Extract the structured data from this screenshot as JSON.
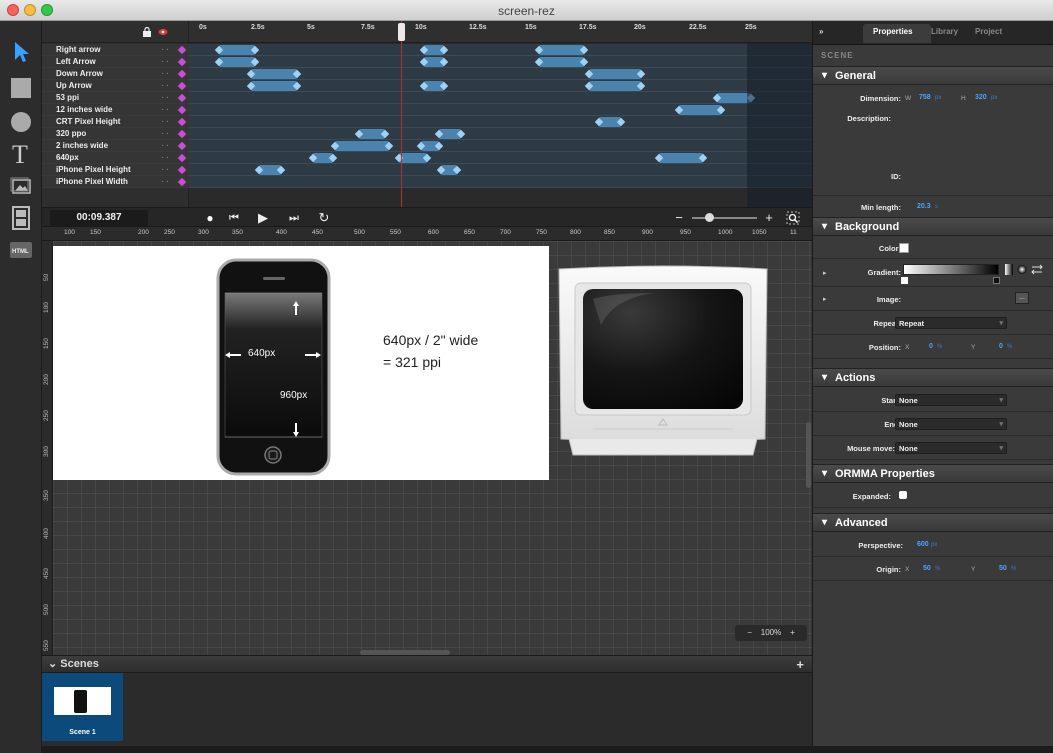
{
  "window": {
    "title": "screen-rez"
  },
  "timeline": {
    "layers": [
      "Right arrow",
      "Left Arrow",
      "Down Arrow",
      "Up Arrow",
      "53 ppi",
      "12 inches wide",
      "CRT Pixel Height",
      "320 ppo",
      "2 inches wide",
      "640px",
      "iPhone Pixel Height",
      "iPhone Pixel Width"
    ],
    "ruler_labels": [
      "0s",
      "2.5s",
      "5s",
      "7.5s",
      "10s",
      "12.5s",
      "15s",
      "17.5s",
      "20s",
      "22.5s",
      "25s"
    ],
    "layer_dots": "·  ·",
    "lock_icon": "lock-icon",
    "visibility_icon": "eye-icon"
  },
  "transport": {
    "timecode": "00:09.387",
    "record": "●",
    "rewind": "⏮",
    "play": "▶",
    "forward": "⏭",
    "loop": "↻",
    "zoom_out": "−",
    "zoom_in": "+"
  },
  "stage_ruler": {
    "horizontal": [
      "100",
      "150",
      "200",
      "250",
      "300",
      "350",
      "400",
      "450",
      "500",
      "550",
      "600",
      "650",
      "700",
      "750",
      "800",
      "850",
      "900",
      "950",
      "1000",
      "1050",
      "11"
    ],
    "vertical": [
      "50",
      "100",
      "150",
      "200",
      "250",
      "300",
      "350",
      "400",
      "450",
      "500",
      "550"
    ]
  },
  "stage": {
    "iphone_width_label": "640px",
    "iphone_height_label": "960px",
    "caption_line1": "640px / 2\" wide",
    "caption_line2": "= 321 ppi",
    "zoom": "100%",
    "zoom_minus": "−",
    "zoom_plus": "+"
  },
  "scenes": {
    "header": "Scenes",
    "add": "+",
    "items": [
      {
        "label": "Scene 1"
      }
    ]
  },
  "inspector": {
    "collapse": "»",
    "tabs": [
      "Properties",
      "Library",
      "Project"
    ],
    "active_tab": "Properties",
    "caption": "SCENE",
    "sections": {
      "general": "General",
      "background": "Background",
      "actions": "Actions",
      "ormma": "ORMMA Properties",
      "advanced": "Advanced"
    },
    "general": {
      "dimension_label": "Dimension:",
      "w_label": "W",
      "w_value": "758",
      "w_unit": "px",
      "h_label": "H",
      "h_value": "320",
      "h_unit": "px",
      "description_label": "Description:",
      "id_label": "ID:",
      "min_length_label": "Min length:",
      "min_length_value": "20.3",
      "min_length_unit": "s"
    },
    "background": {
      "color_label": "Color:",
      "color_value": "#ffffff",
      "gradient_label": "Gradient:",
      "image_label": "Image:",
      "image_button": "...",
      "repeat_label": "Repeat:",
      "repeat_value": "Repeat",
      "position_label": "Position:",
      "x_label": "X",
      "x_value": "0",
      "x_unit": "%",
      "y_label": "Y",
      "y_value": "0",
      "y_unit": "%"
    },
    "actions": {
      "start_label": "Start:",
      "start_value": "None",
      "end_label": "End:",
      "end_value": "None",
      "mouse_move_label": "Mouse move:",
      "mouse_move_value": "None"
    },
    "ormma": {
      "expanded_label": "Expanded:"
    },
    "advanced": {
      "perspective_label": "Perspective:",
      "perspective_value": "600",
      "perspective_unit": "px",
      "origin_label": "Origin:",
      "ox_label": "X",
      "ox_value": "50",
      "ox_unit": "%",
      "oy_label": "Y",
      "oy_value": "50",
      "oy_unit": "%"
    }
  },
  "colors": {
    "accent": "#4da3ff",
    "keyframe_bar": "#4a83ad",
    "keyframe_marker": "#c94fd8",
    "playhead": "#aa3333"
  }
}
